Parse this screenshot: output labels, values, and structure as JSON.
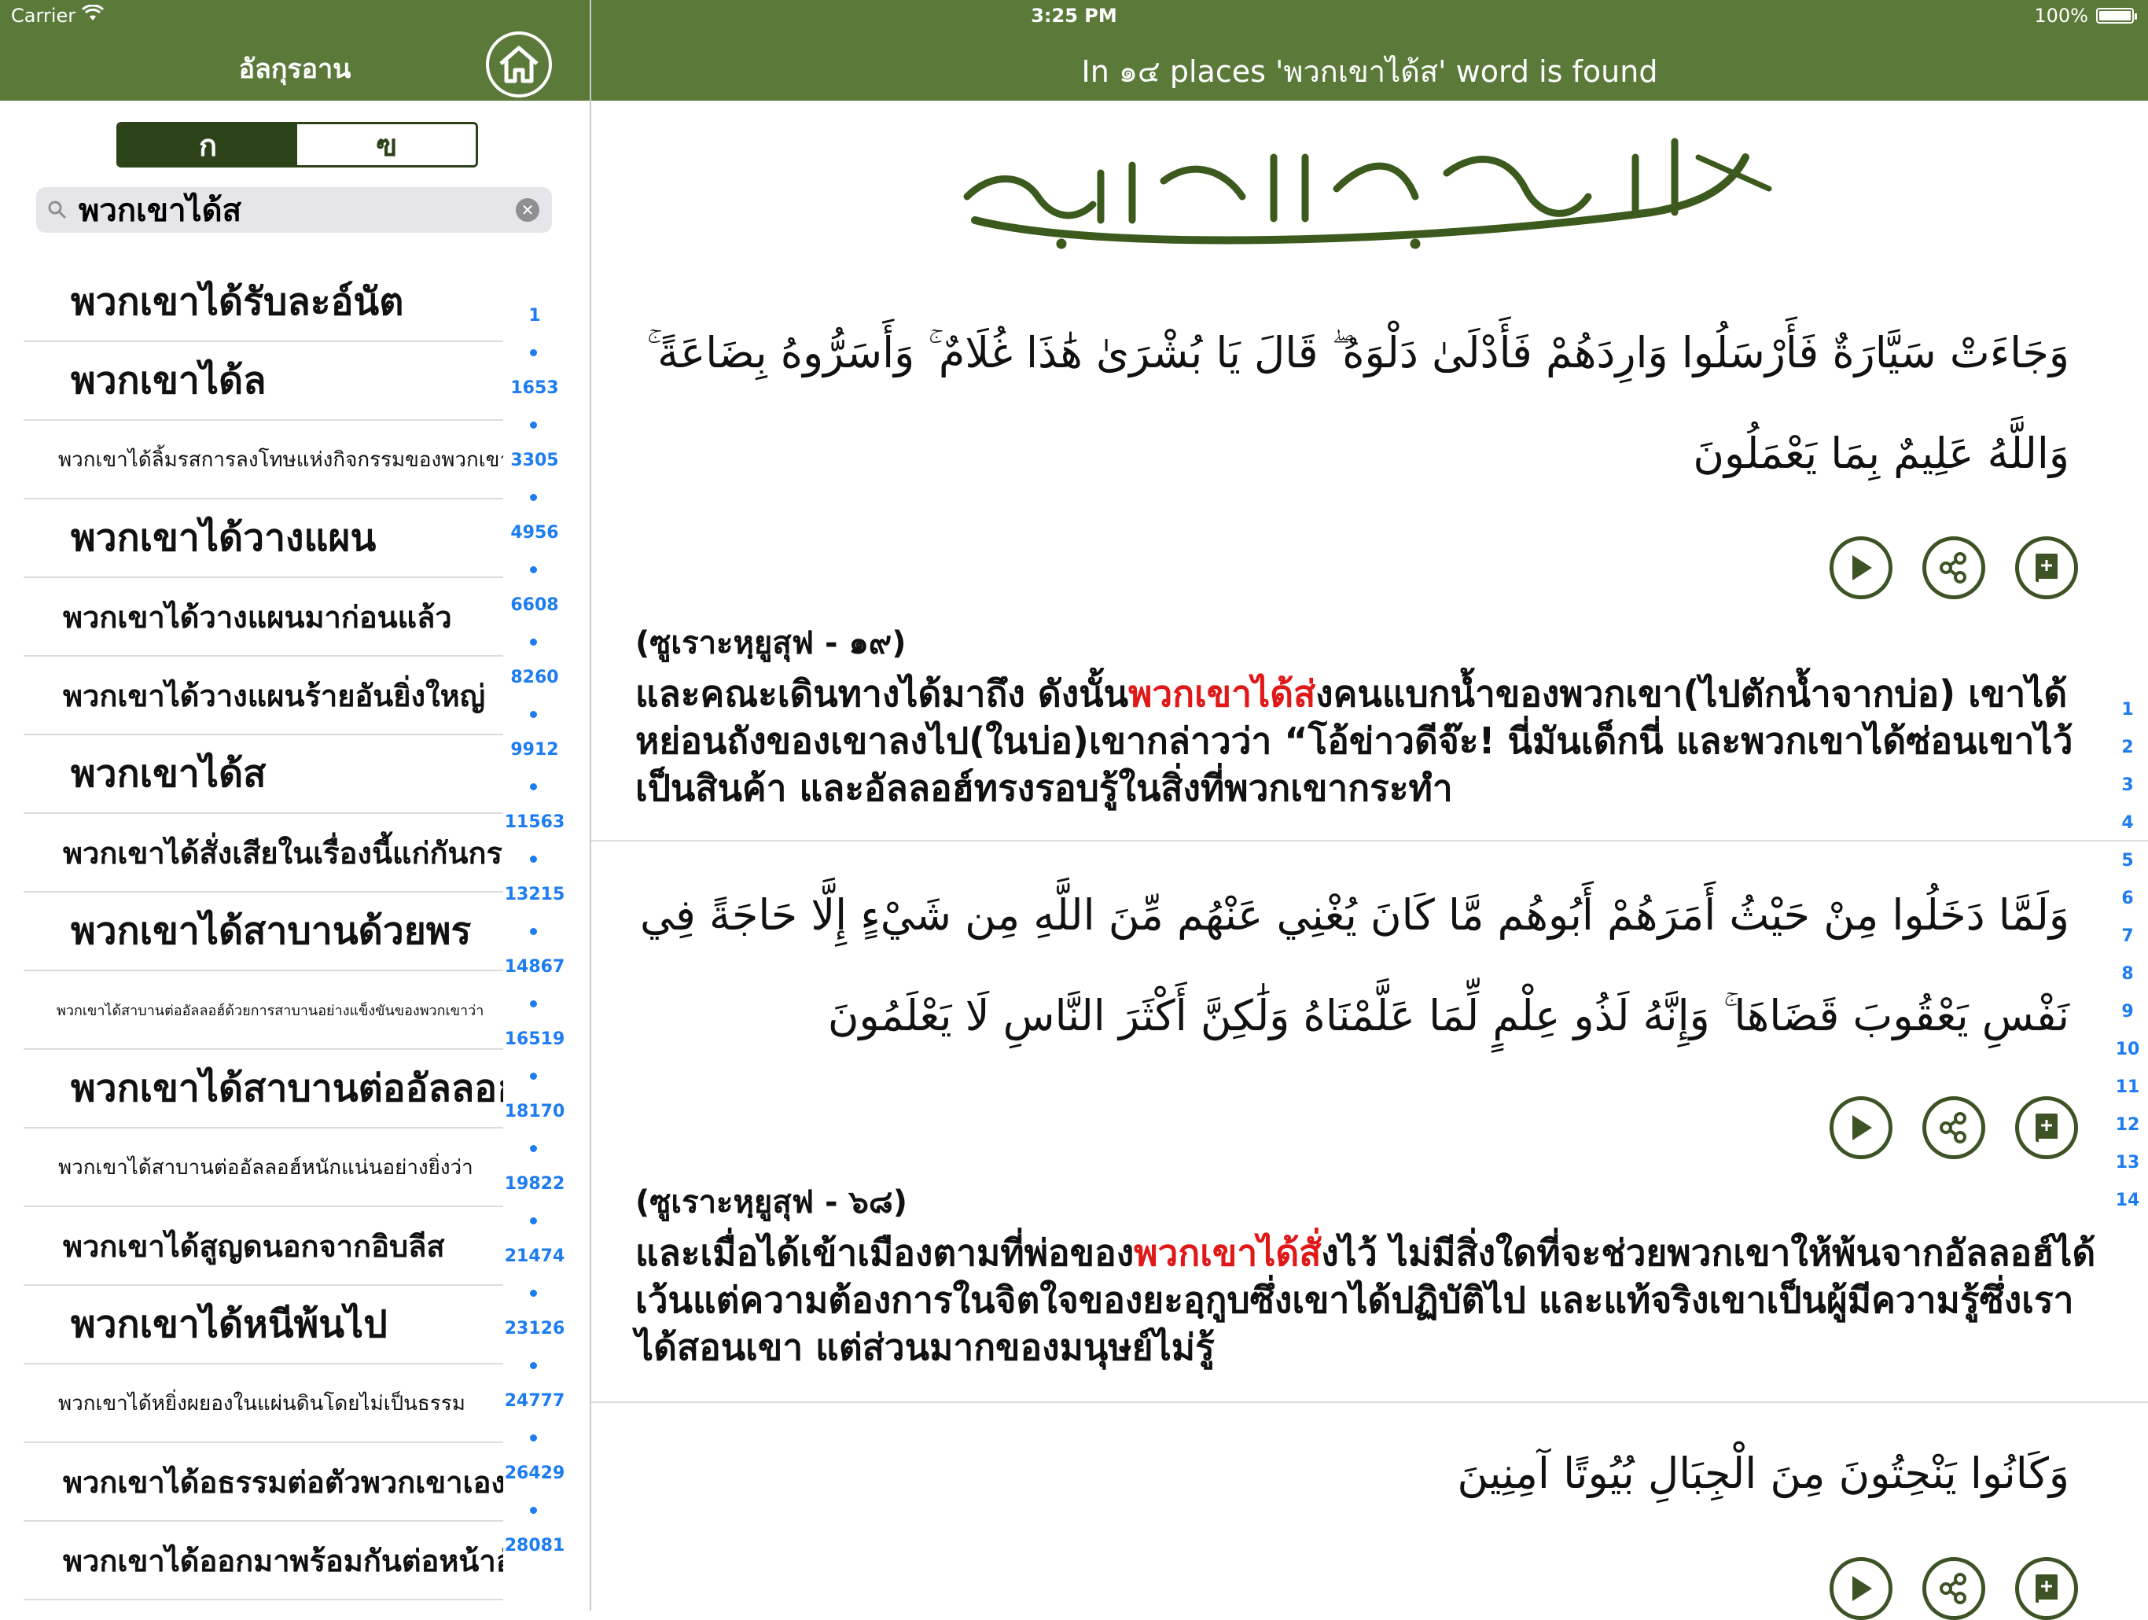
{
  "status_bar": {
    "carrier": "Carrier",
    "time": "3:25 PM",
    "battery": "100%",
    "battery_level": 1.0
  },
  "sidebar": {
    "title": "อัลกุรอาน",
    "segments": [
      {
        "label": "ก",
        "active": true
      },
      {
        "label": "ฃ",
        "active": false
      }
    ],
    "search": {
      "value": "พวกเขาได้ส"
    },
    "results": [
      {
        "text": "พวกเขาได้รับละอ์นัต",
        "size": "lg"
      },
      {
        "text": "พวกเขาได้ล",
        "size": "lg"
      },
      {
        "text": "พวกเขาได้ลิ้มรสการลงโทษแห่งกิจกรรมของพวกเขา",
        "size": "sm"
      },
      {
        "text": "พวกเขาได้วางแผน",
        "size": "lg"
      },
      {
        "text": "พวกเขาได้วางแผนมาก่อนแล้ว",
        "size": "md"
      },
      {
        "text": "พวกเขาได้วางแผนร้ายอันยิ่งใหญ่",
        "size": "md"
      },
      {
        "text": "พวกเขาได้ส",
        "size": "lg"
      },
      {
        "text": "พวกเขาได้สั่งเสียในเรื่องนี้แก่กันกร",
        "size": "md"
      },
      {
        "text": "พวกเขาได้สาบานด้วยพร",
        "size": "lg"
      },
      {
        "text": "พวกเขาได้สาบานต่ออัลลอฮ์ด้วยการสาบานอย่างแข็งขันของพวกเขาว่า",
        "size": "xs"
      },
      {
        "text": "พวกเขาได้สาบานต่ออัลลอฮ์",
        "size": "lg"
      },
      {
        "text": "พวกเขาได้สาบานต่ออัลลอฮ์หนักแน่นอย่างยิ่งว่า",
        "size": "sm"
      },
      {
        "text": "พวกเขาได้สูญดนอกจากอิบลีส",
        "size": "md"
      },
      {
        "text": "พวกเขาได้หนีพ้นไป",
        "size": "lg"
      },
      {
        "text": "พวกเขาได้หยิ่งผยองในแผ่นดินโดยไม่เป็นธรรม",
        "size": "sm"
      },
      {
        "text": "พวกเขาได้อธรรมต่อตัวพวกเขาเอง",
        "size": "md"
      },
      {
        "text": "พวกเขาได้ออกมาพร้อมกันต่อหน้าอัลลอฮ",
        "size": "md"
      }
    ],
    "index": [
      "1",
      "1653",
      "3305",
      "4956",
      "6608",
      "8260",
      "9912",
      "11563",
      "13215",
      "14867",
      "16519",
      "18170",
      "19822",
      "21474",
      "23126",
      "24777",
      "26429",
      "28081"
    ]
  },
  "main": {
    "header_title": "In ๑๔ places 'พวกเขาได้ส' word is found",
    "verses": [
      {
        "arabic": "وَجَاءَتْ سَيَّارَةٌ فَأَرْسَلُوا وَارِدَهُمْ فَأَدْلَىٰ دَلْوَهُ ۖ قَالَ يَا بُشْرَىٰ هَٰذَا غُلَامٌ ۚ وَأَسَرُّوهُ بِضَاعَةً ۚ وَاللَّهُ عَلِيمٌ بِمَا يَعْمَلُونَ",
        "reference": "(ซูเราะหฺยูสุฟ - ๑๙)",
        "trans_before": "และคณะเดินทางได้มาถึง ดังนั้น",
        "trans_highlight": "พวกเขาได้ส่",
        "trans_after": "งคนแบกน้ำของพวกเขา(ไปตักน้ำจากบ่อ) เขาได้หย่อนถังของเขาลงไป(ในบ่อ)เขากล่าวว่า “โอ้ข่าวดีจ๊ะ! นี่มันเด็กนี่ และพวกเขาได้ซ่อนเขาไว้เป็นสินค้า และอัลลอฮ์ทรงรอบรู้ในสิ่งที่พวกเขากระทำ"
      },
      {
        "arabic": "وَلَمَّا دَخَلُوا مِنْ حَيْثُ أَمَرَهُمْ أَبُوهُم مَّا كَانَ يُغْنِي عَنْهُم مِّنَ اللَّهِ مِن شَيْءٍ إِلَّا حَاجَةً فِي نَفْسِ يَعْقُوبَ قَضَاهَا ۚ وَإِنَّهُ لَذُو عِلْمٍ لِّمَا عَلَّمْنَاهُ وَلَٰكِنَّ أَكْثَرَ النَّاسِ لَا يَعْلَمُونَ",
        "reference": "(ซูเราะหฺยูสุฟ - ๖๘)",
        "trans_before": "และเมื่อได้เข้าเมืองตามที่พ่อของ",
        "trans_highlight": "พวกเขาได้สั่",
        "trans_after": "งไว้ ไม่มีสิ่งใดที่จะช่วยพวกเขาให้พ้นจากอัลลอฮ์ได้ เว้นแต่ความต้องการในจิตใจของยะอฺกูบซึ่งเขาได้ปฏิบัติไป และแท้จริงเขาเป็นผู้มีความรู้ซึ่งเราได้สอนเขา แต่ส่วนมากของมนุษย์ไม่รู้"
      },
      {
        "arabic": "وَكَانُوا يَنْحِتُونَ مِنَ الْجِبَالِ بُيُوتًا آمِنِينَ"
      }
    ],
    "occurrence_index": [
      "1",
      "2",
      "3",
      "4",
      "5",
      "6",
      "7",
      "8",
      "9",
      "10",
      "11",
      "12",
      "13",
      "14"
    ]
  },
  "colors": {
    "nav_green": "#5b7a3a",
    "dark_green": "#2c4219",
    "highlight_red": "#e01818",
    "index_blue": "#1d7cf2"
  },
  "icons": [
    "wifi-icon",
    "battery-icon",
    "home-icon",
    "search-icon",
    "clear-icon",
    "play-icon",
    "share-icon",
    "bookmark-book-icon"
  ]
}
